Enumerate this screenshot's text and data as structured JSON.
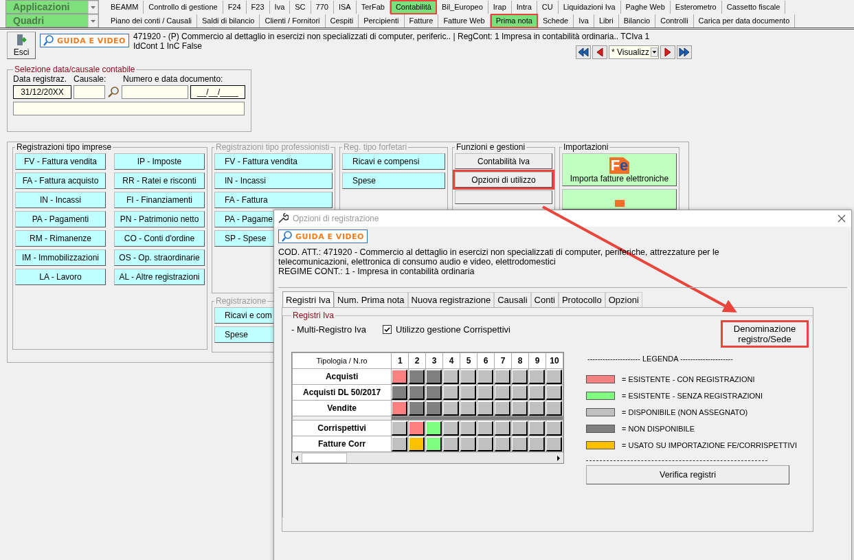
{
  "menu": {
    "combo_1": "Applicazioni",
    "combo_2": "Quadri",
    "tabs_1": [
      {
        "label": "BEAMM",
        "selected": false
      },
      {
        "label": "Controllo di gestione",
        "selected": false
      },
      {
        "label": "F24",
        "selected": false
      },
      {
        "label": "F23",
        "selected": false
      },
      {
        "label": "Iva",
        "selected": false
      },
      {
        "label": "SC",
        "selected": false
      },
      {
        "label": "770",
        "selected": false
      },
      {
        "label": "ISA",
        "selected": false
      },
      {
        "label": "TerFab",
        "selected": false
      },
      {
        "label": "Contabilità",
        "selected": true
      },
      {
        "label": "Bil_Europeo",
        "selected": false
      },
      {
        "label": "Irap",
        "selected": false
      },
      {
        "label": "Intra",
        "selected": false
      },
      {
        "label": "CU",
        "selected": false
      },
      {
        "label": "Liquidazioni Iva",
        "selected": false
      },
      {
        "label": "Paghe Web",
        "selected": false
      },
      {
        "label": "Esterometro",
        "selected": false
      },
      {
        "label": "Cassetto fiscale",
        "selected": false
      }
    ],
    "tabs_2": [
      {
        "label": "Piano dei conti / Causali",
        "selected": false
      },
      {
        "label": "Saldi di bilancio",
        "selected": false
      },
      {
        "label": "Clienti / Fornitori",
        "selected": false
      },
      {
        "label": "Cespiti",
        "selected": false
      },
      {
        "label": "Percipienti",
        "selected": false
      },
      {
        "label": "Fatture",
        "selected": false
      },
      {
        "label": "Fatture Web",
        "selected": false
      },
      {
        "label": "Prima nota",
        "selected": true
      },
      {
        "label": "Schede",
        "selected": false
      },
      {
        "label": "Iva",
        "selected": false
      },
      {
        "label": "Libri",
        "selected": false
      },
      {
        "label": "Bilancio",
        "selected": false
      },
      {
        "label": "Controlli",
        "selected": false
      },
      {
        "label": "Carica per data documento",
        "selected": false
      }
    ]
  },
  "header": {
    "exit_button": "Esci",
    "guide_button": "GUIDA E VIDEO",
    "info_lines": [
      "471920 - (P) Commercio al dettaglio in esercizi non specializzati di computer, periferic.. | RegCont: 1 Impresa  in contabilità ordinaria..  TCIva 1",
      "IdCont 1 InC False"
    ],
    "view_combo": "* Visualizz"
  },
  "selection": {
    "title": "Selezione data/causale contabile",
    "labels": [
      "Data registraz.",
      "Causale:",
      "Numero e data documento:"
    ],
    "date_value": "31/12/20XX",
    "doc_date_value": "__/__/____"
  },
  "groups": {
    "imprese": {
      "title": "Registrazioni tipo imprese",
      "buttons": [
        "FV - Fattura vendita",
        "IP - Imposte",
        "FA - Fattura acquisto",
        "RR - Ratei e risconti",
        "IN - Incassi",
        "FI - Finanziamenti",
        "PA - Pagamenti",
        "PN - Patrimonio netto",
        "RM - Rimanenze",
        "CO - Conti d'ordine",
        "IM - Immobilizzazioni",
        "OS - Op. straordinarie",
        "LA - Lavoro",
        "AL - Altre registrazioni"
      ]
    },
    "professionisti": {
      "title": "Registrazioni tipo professionisti",
      "buttons": [
        "FV - Fattura vendita",
        "IN - Incassi",
        "FA - Fattura",
        "PA - Pagame",
        "SP - Spese"
      ]
    },
    "registrazione": {
      "title": "Registrazione",
      "buttons": [
        "Ricavi e com",
        "Spese"
      ]
    },
    "forfetari": {
      "title": "Reg. tipo forfetari",
      "buttons": [
        "Ricavi e compensi",
        "Spese"
      ]
    },
    "funzioni": {
      "title": "Funzioni e gestioni",
      "buttons": [
        {
          "label": "Contabilità Iva",
          "highlighted": false
        },
        {
          "label": "Opzioni di utilizzo",
          "highlighted": true
        }
      ]
    },
    "importazioni": {
      "title": "Importazioni",
      "logo": "Fe",
      "button": "Importa fatture elettroniche"
    }
  },
  "dialog": {
    "title": "Opzioni di registrazione",
    "guide_button": "GUIDA E VIDEO",
    "info_lines": [
      "COD. ATT.: 471920 - Commercio al dettaglio in esercizi non specializzati di computer, periferiche, attrezzature per le",
      "telecomunicazioni, elettronica di consumo audio e video, elettrodomestici",
      "REGIME CONT.: 1 - Impresa  in contabilità ordinaria"
    ],
    "tabs": [
      {
        "label": "Registri Iva",
        "selected": true
      },
      {
        "label": "Num. Prima nota",
        "selected": false
      },
      {
        "label": "Nuova registrazione",
        "selected": false
      },
      {
        "label": "Causali",
        "selected": false
      },
      {
        "label": "Conti",
        "selected": false
      },
      {
        "label": "Protocollo",
        "selected": false
      },
      {
        "label": "Opzioni",
        "selected": false
      }
    ],
    "group_title": "Registri Iva",
    "multi_label": "- Multi-Registro Iva",
    "corr_checkbox": {
      "label": "Utilizzo gestione Corrispettivi",
      "checked": true
    },
    "denomination": {
      "label": "Denominazione registro/Sede",
      "highlighted": true
    },
    "grid": {
      "corner": "Tipologia / N.ro",
      "columns": [
        "1",
        "2",
        "3",
        "4",
        "5",
        "6",
        "7",
        "8",
        "9",
        "10"
      ],
      "register_rows": [
        {
          "label": "Acquisti",
          "cells": [
            {
              "color": "#ff8080"
            },
            {
              "color": "#808080"
            },
            {
              "color": "#808080"
            },
            {
              "color": "#c0c0c0"
            },
            {
              "color": "#c0c0c0"
            },
            {
              "color": "#c0c0c0"
            },
            {
              "color": "#c0c0c0"
            },
            {
              "color": "#c0c0c0"
            },
            {
              "color": "#c0c0c0"
            },
            {
              "color": "#c0c0c0"
            }
          ]
        },
        {
          "label": "Acquisti DL 50/2017",
          "cells": [
            {
              "color": "#808080"
            },
            {
              "color": "#808080"
            },
            {
              "color": "#808080"
            },
            {
              "color": "#c0c0c0"
            },
            {
              "color": "#c0c0c0"
            },
            {
              "color": "#c0c0c0"
            },
            {
              "color": "#c0c0c0"
            },
            {
              "color": "#c0c0c0"
            },
            {
              "color": "#c0c0c0"
            },
            {
              "color": "#c0c0c0"
            }
          ]
        },
        {
          "label": "Vendite",
          "cells": [
            {
              "color": "#ff8080"
            },
            {
              "color": "#808080"
            },
            {
              "color": "#808080"
            },
            {
              "color": "#c0c0c0"
            },
            {
              "color": "#c0c0c0"
            },
            {
              "color": "#c0c0c0"
            },
            {
              "color": "#c0c0c0"
            },
            {
              "color": "#c0c0c0"
            },
            {
              "color": "#c0c0c0"
            },
            {
              "color": "#c0c0c0"
            }
          ]
        }
      ],
      "corr_rows": [
        {
          "label": "Corrispettivi",
          "cells": [
            {
              "color": "#c0c0c0"
            },
            {
              "color": "#ff8080"
            },
            {
              "color": "#80ff80"
            },
            {
              "color": "#c0c0c0"
            },
            {
              "color": "#c0c0c0"
            },
            {
              "color": "#c0c0c0"
            },
            {
              "color": "#c0c0c0"
            },
            {
              "color": "#c0c0c0"
            },
            {
              "color": "#c0c0c0"
            },
            {
              "color": "#c0c0c0"
            }
          ]
        },
        {
          "label": "Fatture Corr",
          "cells": [
            {
              "color": "#c0c0c0"
            },
            {
              "color": "#ffc000"
            },
            {
              "color": "#80ff80"
            },
            {
              "color": "#c0c0c0"
            },
            {
              "color": "#c0c0c0"
            },
            {
              "color": "#c0c0c0"
            },
            {
              "color": "#c0c0c0"
            },
            {
              "color": "#c0c0c0"
            },
            {
              "color": "#c0c0c0"
            },
            {
              "color": "#c0c0c0"
            }
          ]
        }
      ]
    },
    "legend": {
      "title": "--------------------- LEGENDA ---------------------",
      "items": [
        {
          "label": "=  ESISTENTE - CON REGISTRAZIONI",
          "color": "#ff8080"
        },
        {
          "label": "=  ESISTENTE - SENZA REGISTRAZIONI",
          "color": "#80ff80"
        },
        {
          "label": "=  DISPONIBILE (NON ASSEGNATO)",
          "color": "#c0c0c0"
        },
        {
          "label": "=  NON DISPONIBILE",
          "color": "#808080"
        },
        {
          "label": "=  USATO SU IMPORTAZIONE FE/CORRISPETTIVI",
          "color": "#ffc000"
        }
      ]
    },
    "verify_button": "Verifica registri"
  }
}
